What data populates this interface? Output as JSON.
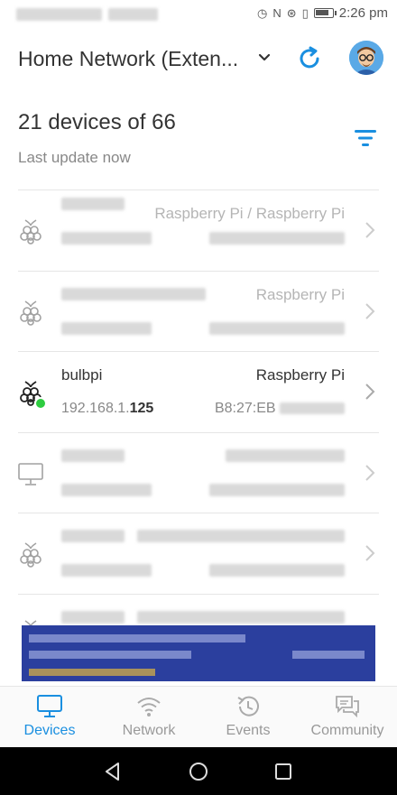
{
  "status_bar": {
    "time": "2:26 pm"
  },
  "header": {
    "network_title": "Home Network (Exten...",
    "colors": {
      "accent": "#1a8fe0"
    }
  },
  "summary": {
    "devices_text": "21 devices of 66",
    "last_update": "Last update now"
  },
  "devices": [
    {
      "name": "",
      "vendor": "Raspberry Pi / Raspberry Pi",
      "ip_prefix": "",
      "ip_suffix": "",
      "mac": "",
      "icon": "raspberry-pi-icon",
      "online": false
    },
    {
      "name": "",
      "vendor": "Raspberry Pi",
      "ip_prefix": "",
      "ip_suffix": "",
      "mac": "",
      "icon": "raspberry-pi-icon",
      "online": false
    },
    {
      "name": "bulbpi",
      "vendor": "Raspberry Pi",
      "ip_prefix": "192.168.1.",
      "ip_suffix": "125",
      "mac": "B8:27:EB",
      "icon": "raspberry-pi-icon",
      "online": true
    },
    {
      "name": "",
      "vendor": "",
      "ip_prefix": "",
      "ip_suffix": "",
      "mac": "",
      "icon": "desktop-icon",
      "online": false
    },
    {
      "name": "",
      "vendor": "",
      "ip_prefix": "",
      "ip_suffix": "",
      "mac": "",
      "icon": "raspberry-pi-icon",
      "online": false
    },
    {
      "name": "",
      "vendor": "",
      "ip_prefix": "",
      "ip_suffix": "",
      "mac": "",
      "icon": "raspberry-pi-icon",
      "online": false
    }
  ],
  "bottom_nav": {
    "items": [
      {
        "label": "Devices",
        "icon": "monitor-icon",
        "active": true
      },
      {
        "label": "Network",
        "icon": "wifi-icon",
        "active": false
      },
      {
        "label": "Events",
        "icon": "history-icon",
        "active": false
      },
      {
        "label": "Community",
        "icon": "chat-icon",
        "active": false
      }
    ]
  }
}
